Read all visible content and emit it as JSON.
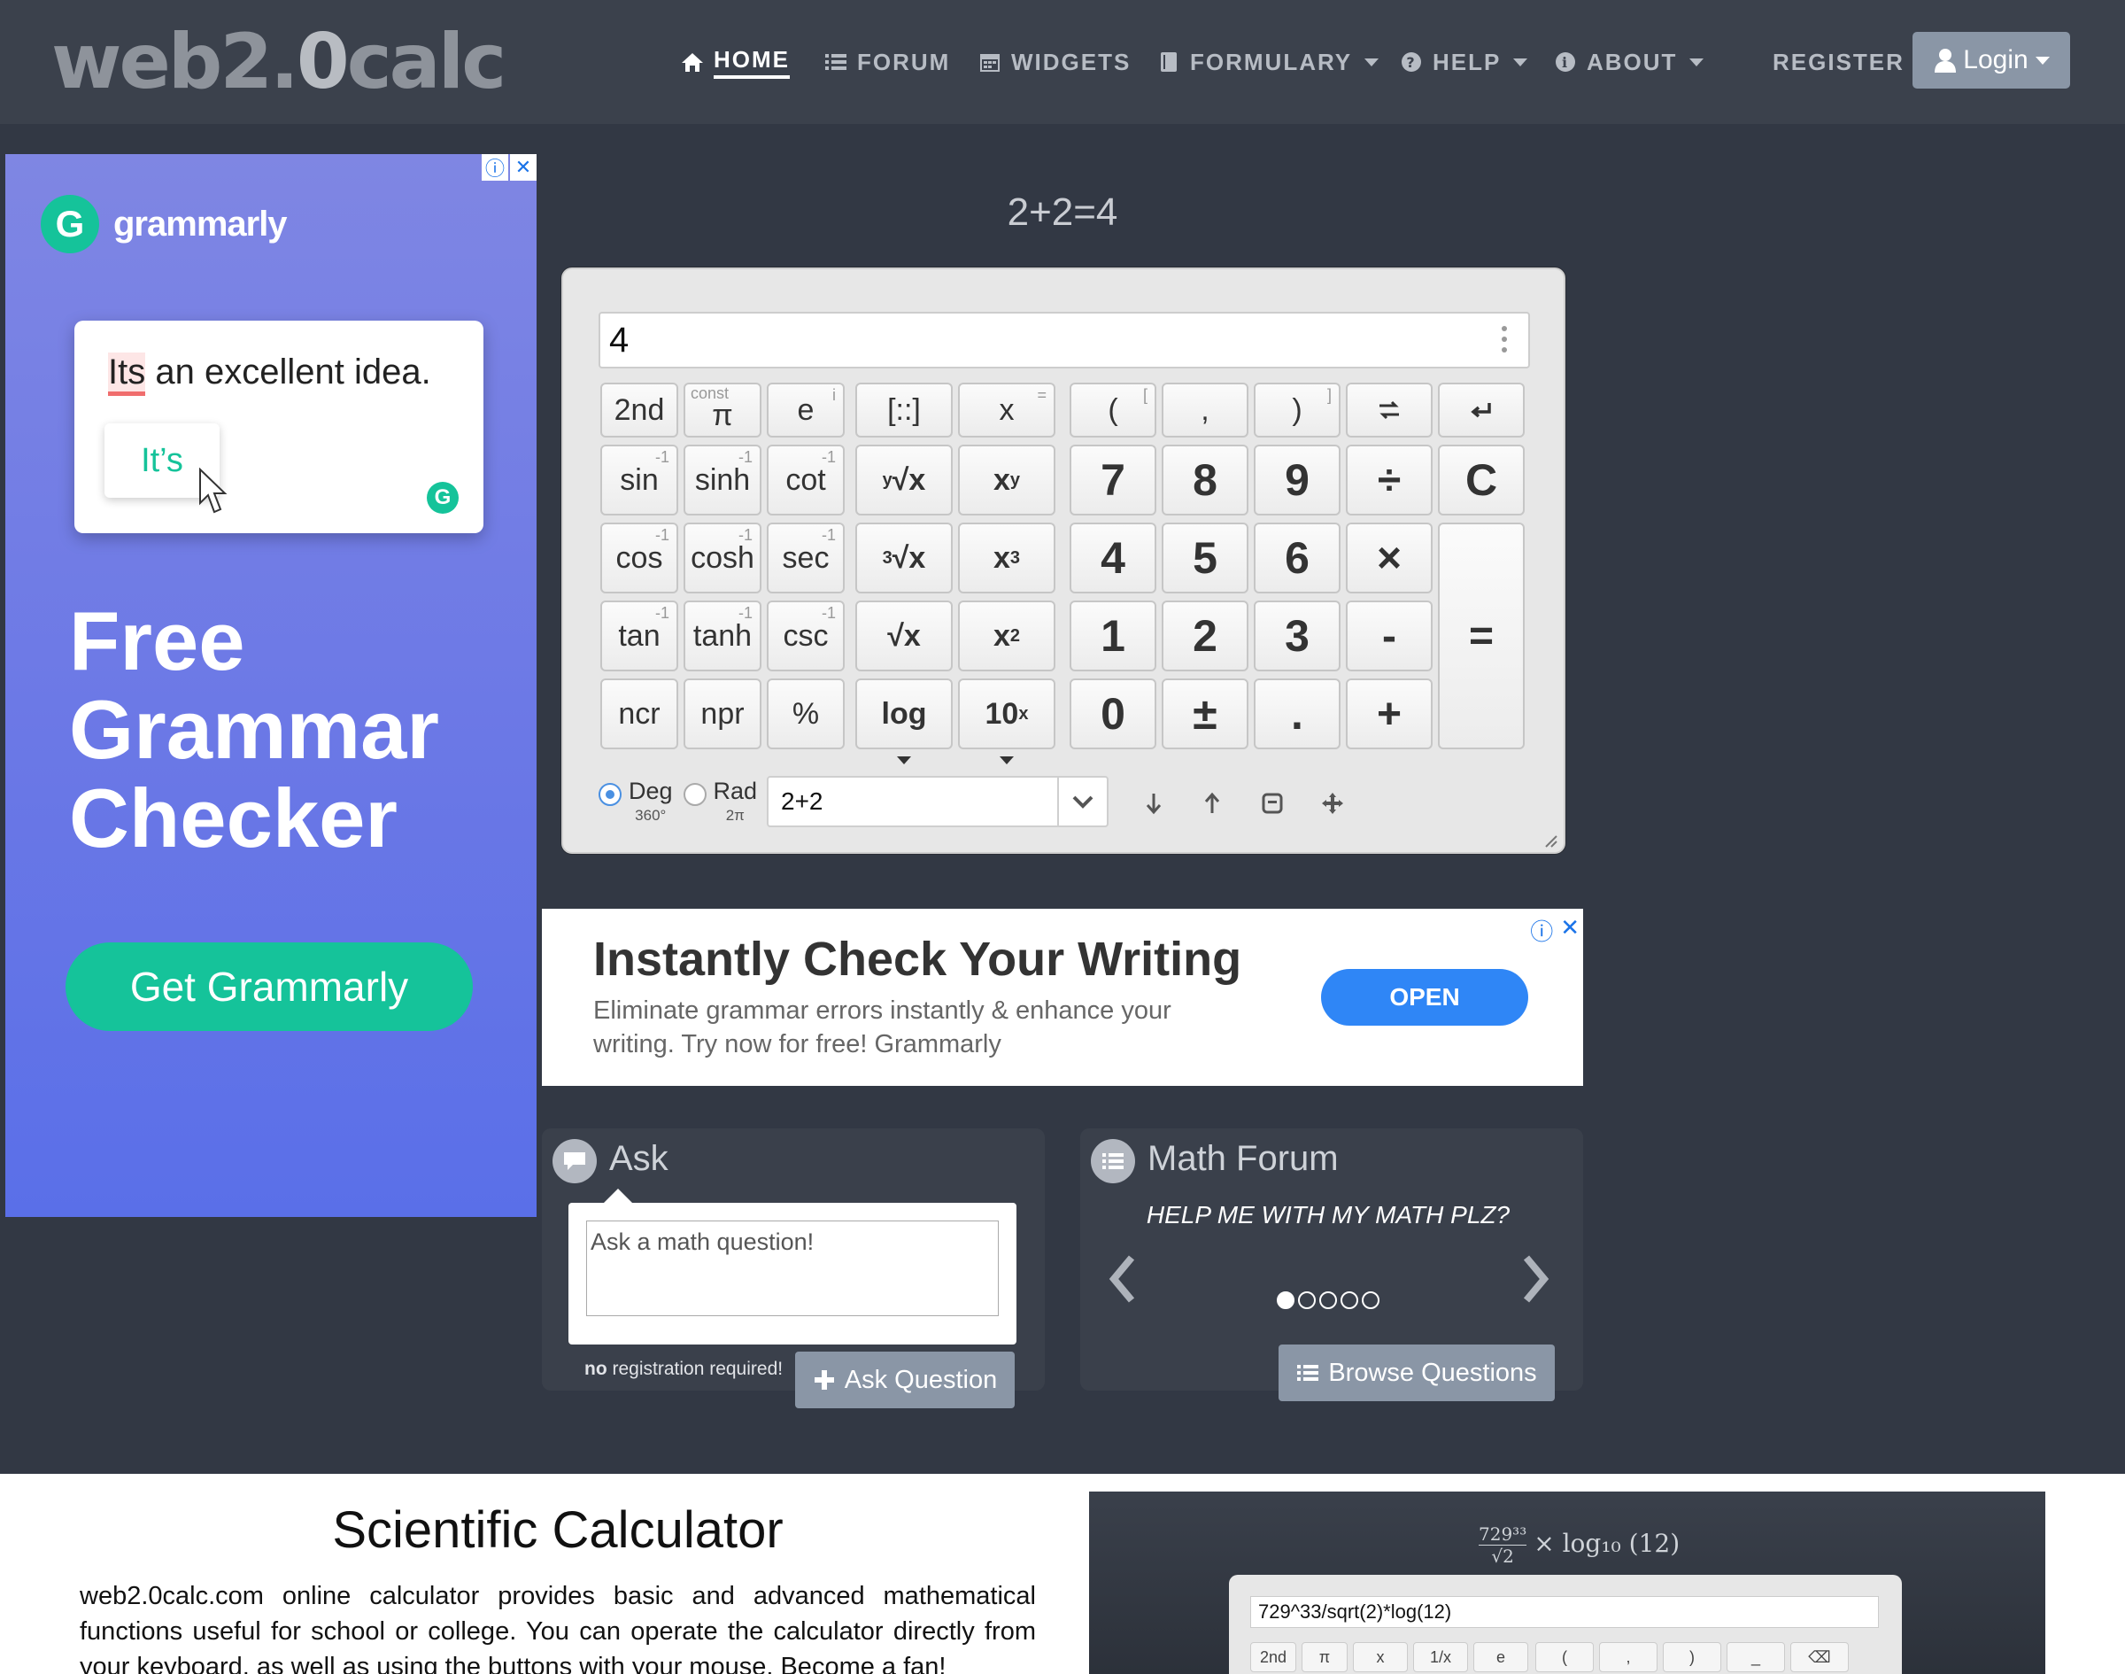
{
  "navbar": {
    "logo_main": "web2.",
    "logo_mid": "0",
    "logo_end": "calc",
    "items": [
      {
        "label": "HOME",
        "icon": "home-icon"
      },
      {
        "label": "FORUM",
        "icon": "list-icon"
      },
      {
        "label": "WIDGETS",
        "icon": "calendar-icon"
      },
      {
        "label": "FORMULARY",
        "icon": "book-icon"
      },
      {
        "label": "HELP",
        "icon": "question-icon"
      },
      {
        "label": "ABOUT",
        "icon": "info-icon"
      }
    ],
    "register": "REGISTER",
    "login": "Login"
  },
  "left_ad": {
    "brand": "grammarly",
    "brand_initial": "G",
    "card_text_mis": "Its",
    "card_text_rest": " an excellent idea.",
    "suggestion": "It’s",
    "headline_1": "Free",
    "headline_2": "Grammar",
    "headline_3": "Checker",
    "cta": "Get Grammarly"
  },
  "calculator": {
    "result_line": "2+2=4",
    "display": "4",
    "keys": {
      "second": "2nd",
      "const": "const",
      "pi": "π",
      "e": "e",
      "matrix": "[::]",
      "x": "x",
      "lparen": "(",
      "comma": ",",
      "rparen": ")",
      "sin": "sin",
      "sinh": "sinh",
      "cot": "cot",
      "yroot": "√x",
      "yroot_pre": "y",
      "xpow": "x",
      "xpow_sup": "y",
      "cos": "cos",
      "cosh": "cosh",
      "sec": "sec",
      "croot": "√x",
      "croot_pre": "3",
      "cube": "x",
      "cube_sup": "3",
      "tan": "tan",
      "tanh": "tanh",
      "csc": "csc",
      "sqrt": "√x",
      "square": "x",
      "square_sup": "2",
      "ncr": "ncr",
      "npr": "npr",
      "percent": "%",
      "log": "log",
      "ten": "10",
      "ten_sup": "x",
      "n7": "7",
      "n8": "8",
      "n9": "9",
      "div": "÷",
      "clear": "C",
      "n4": "4",
      "n5": "5",
      "n6": "6",
      "mul": "×",
      "n1": "1",
      "n2": "2",
      "n3": "3",
      "minus": "-",
      "equals": "=",
      "n0": "0",
      "plusminus": "±",
      "dot": ".",
      "plus": "+",
      "inv": "-1"
    },
    "deg_label": "Deg",
    "deg_sub": "360°",
    "rad_label": "Rad",
    "rad_sub": "2π",
    "angle_mode": "Deg",
    "history_input": "2+2"
  },
  "mid_ad": {
    "title": "Instantly Check Your Writing",
    "body": "Eliminate grammar errors instantly & enhance your writing. Try now for free! Grammarly",
    "cta": "OPEN"
  },
  "ask_panel": {
    "title": "Ask",
    "placeholder": "Ask a math question!",
    "note_bold": "no",
    "note_rest": " registration required!",
    "button": "Ask Question"
  },
  "forum_panel": {
    "title": "Math Forum",
    "question": "HELP ME WITH MY MATH PLZ?",
    "button": "Browse Questions",
    "active_slide": 1,
    "slide_count": 5
  },
  "bottom": {
    "title": "Scientific Calculator",
    "body": "web2.0calc.com online calculator provides basic and advanced mathematical functions useful for school or college. You can operate the calculator directly from your keyboard, as well as using the buttons with your mouse. Become a fan!",
    "shot_formula": "× log₁₀ (12)",
    "shot_num": "729³³",
    "shot_den": "√2",
    "shot_input": "729^33/sqrt(2)*log(12)",
    "shot_keys": [
      "2nd",
      "π",
      "x",
      "1/x",
      "e",
      "(",
      ",",
      ")",
      "_",
      "⌫"
    ]
  },
  "colors": {
    "page_bg": "#323844",
    "navbar_bg": "#3b414c",
    "accent_blue": "#2f86f6",
    "grammarly_green": "#15c39a",
    "button_grey": "#8a96a6"
  }
}
